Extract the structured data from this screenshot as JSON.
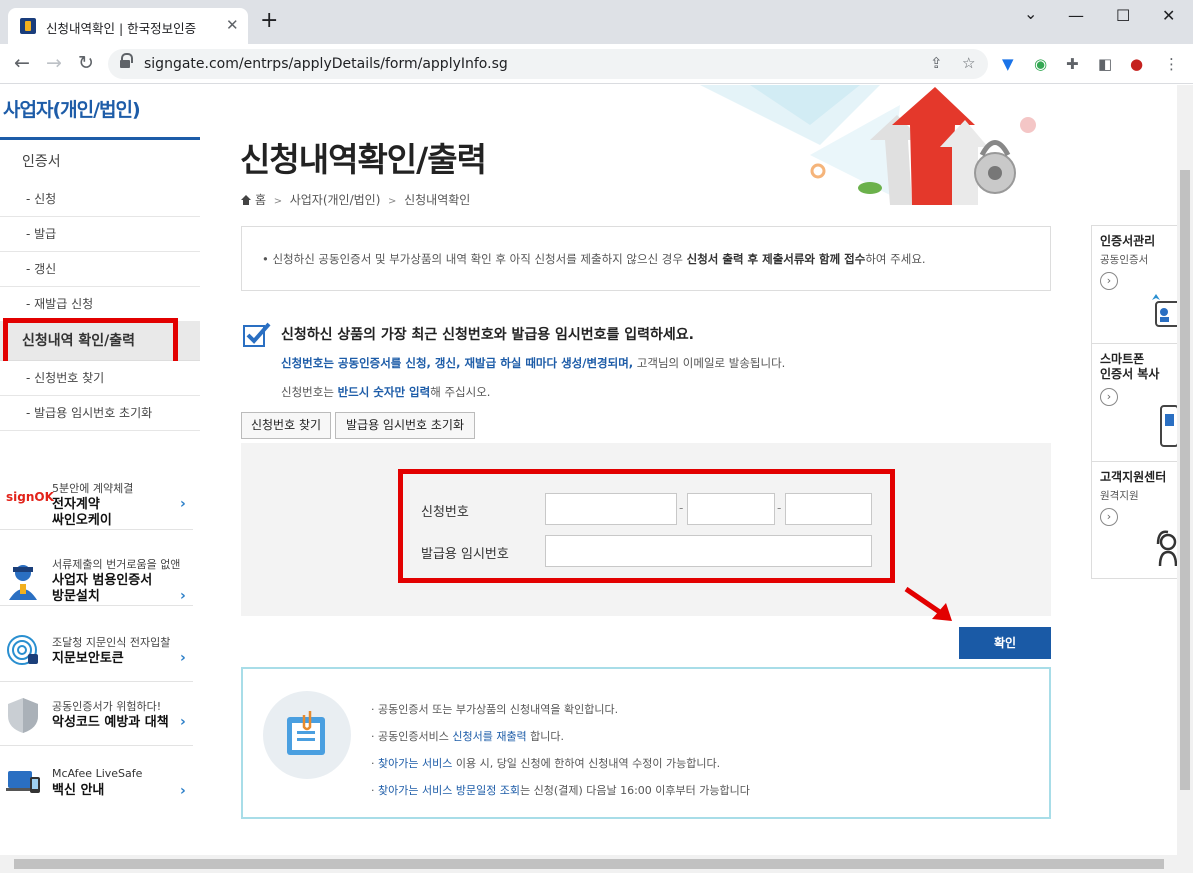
{
  "browser": {
    "tab_title": "신청내역확인 | 한국정보인증",
    "new_tab": "+",
    "url": "signgate.com/entrps/applyDetails/form/applyInfo.sg",
    "minimize": "—",
    "maximize": "☐",
    "close": "✕",
    "chevron": "⌄"
  },
  "sidebar": {
    "title": "사업자(개인/법인)",
    "menu_cert": "인증서",
    "submenu": [
      "- 신청",
      "- 발급",
      "- 갱신",
      "- 재발급 신청"
    ],
    "selected": "신청내역 확인/출력",
    "submenu2": [
      "- 신청번호 찾기",
      "- 발급용 임시번호 초기화"
    ],
    "ads": [
      {
        "sub": "5분안에 계약체결",
        "main1": "전자계약",
        "main2": "싸인오케이",
        "logo": "signOK"
      },
      {
        "sub": "서류제출의 번거로움을 없앤",
        "main1": "사업자 범용인증서",
        "main2": "방문설치"
      },
      {
        "sub": "조달청 지문인식 전자입찰",
        "main1": "지문보안토큰",
        "main2": ""
      },
      {
        "sub": "공동인증서가 위험하다!",
        "main1": "악성코드 예방과 대책",
        "main2": ""
      },
      {
        "sub": "McAfee LiveSafe",
        "main1": "백신 안내",
        "main2": ""
      }
    ],
    "chevron": "›"
  },
  "main": {
    "title": "신청내역확인/출력",
    "breadcrumb": [
      "홈",
      "사업자(개인/법인)",
      "신청내역확인"
    ],
    "crumb_sep": ">",
    "notice": {
      "bullet": "•",
      "pre": "신청하신 공동인증서 및 부가상품의 내역 확인 후 아직 신청서를 제출하지 않으신 경우 ",
      "bold": "신청서 출력 후 제출서류와 함께 접수",
      "post": "하여 주세요."
    },
    "question": "신청하신 상품의 가장 최근 신청번호와 발급용 임시번호를 입력하세요.",
    "line1_blue": "신청번호는 공동인증서를 신청, 갱신, 재발급 하실 때마다 생성/변경되며,",
    "line1_rest": " 고객님의 이메일로 발송됩니다.",
    "line2_pre": "신청번호는 ",
    "line2_blue": "반드시 숫자만 입력",
    "line2_post": "해 주십시오.",
    "btn_find": "신청번호 찾기",
    "btn_reset": "발급용 임시번호 초기화",
    "label_app_no": "신청번호",
    "label_temp_no": "발급용 임시번호",
    "dash": "-",
    "confirm": "확인",
    "info": [
      {
        "pre": "· 공동인증서 또는 부가상품의 신청내역을 확인합니다.",
        "blue": "",
        "post": ""
      },
      {
        "pre": "· 공동인증서비스 ",
        "blue": "신청서를 재출력",
        "post": " 합니다."
      },
      {
        "pre": "· ",
        "blue": "찾아가는 서비스",
        "post": " 이용 시, 당일 신청에 한하여 신청내역 수정이 가능합니다."
      },
      {
        "pre": "· ",
        "blue": "찾아가는 서비스 방문일정 조회",
        "post": "는 신청(결제) 다음날 16:00 이후부터 가능합니다"
      }
    ]
  },
  "quick": [
    {
      "title": "인증서관리",
      "sub": "공동인증서"
    },
    {
      "title": "스마트폰\n인증서 복사",
      "sub": ""
    },
    {
      "title": "고객지원센터",
      "sub": "원격지원"
    }
  ],
  "quick_arrow": "›",
  "colors": {
    "accent": "#1d5ca8",
    "highlight": "#e20000",
    "confirm": "#1a5aa6"
  }
}
